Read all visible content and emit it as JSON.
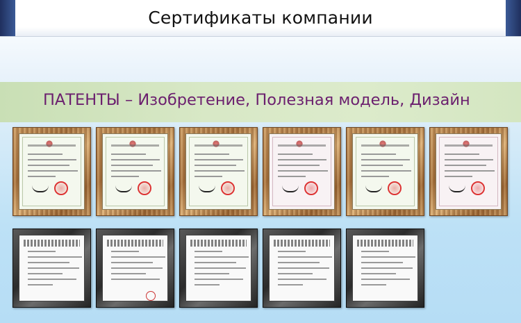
{
  "header": {
    "title": "Сертификаты компании"
  },
  "section": {
    "title": "ПАТЕНТЫ – Изобретение, Полезная модель, Дизайн"
  },
  "certificates_row": {
    "items": [
      {
        "kind": "utility-model-certificate",
        "tint": "green"
      },
      {
        "kind": "utility-model-certificate",
        "tint": "green"
      },
      {
        "kind": "utility-model-certificate",
        "tint": "green"
      },
      {
        "kind": "design-patent-certificate",
        "tint": "pink"
      },
      {
        "kind": "utility-model-certificate",
        "tint": "green"
      },
      {
        "kind": "design-patent-certificate",
        "tint": "pink"
      }
    ]
  },
  "documents_row": {
    "items": [
      {
        "kind": "patent-document"
      },
      {
        "kind": "patent-document"
      },
      {
        "kind": "patent-document"
      },
      {
        "kind": "patent-document"
      },
      {
        "kind": "patent-document"
      }
    ]
  },
  "colors": {
    "section_title": "#6b1f6e",
    "banner": "#d4e6c1",
    "wood_frame": "#b07a44",
    "dark_frame": "#333333",
    "title_edge": "#2b4276"
  }
}
